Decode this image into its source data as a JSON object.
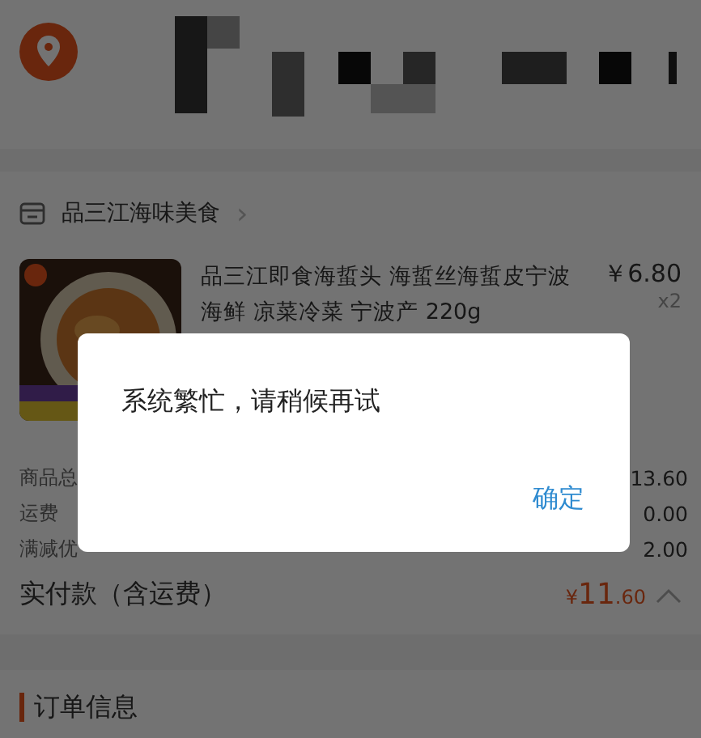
{
  "store": {
    "name": "品三江海味美食",
    "chevron": "›"
  },
  "product": {
    "title": "品三江即食海蜇头 海蜇丝海蜇皮宁波海鲜 凉菜冷菜 宁波产 220g",
    "price": "￥6.80",
    "quantity": "x2"
  },
  "totals": [
    {
      "label": "商品总",
      "value": "13.60"
    },
    {
      "label": "运费",
      "value": "0.00"
    },
    {
      "label": "满减优",
      "value": "2.00"
    }
  ],
  "payment": {
    "label": "实付款（含运费）",
    "currency": "¥",
    "integer": "11",
    "decimal": ".60",
    "expanded": true
  },
  "order_info": {
    "title": "订单信息"
  },
  "dialog": {
    "message": "系统繁忙，请稍候再试",
    "button": "确定"
  }
}
